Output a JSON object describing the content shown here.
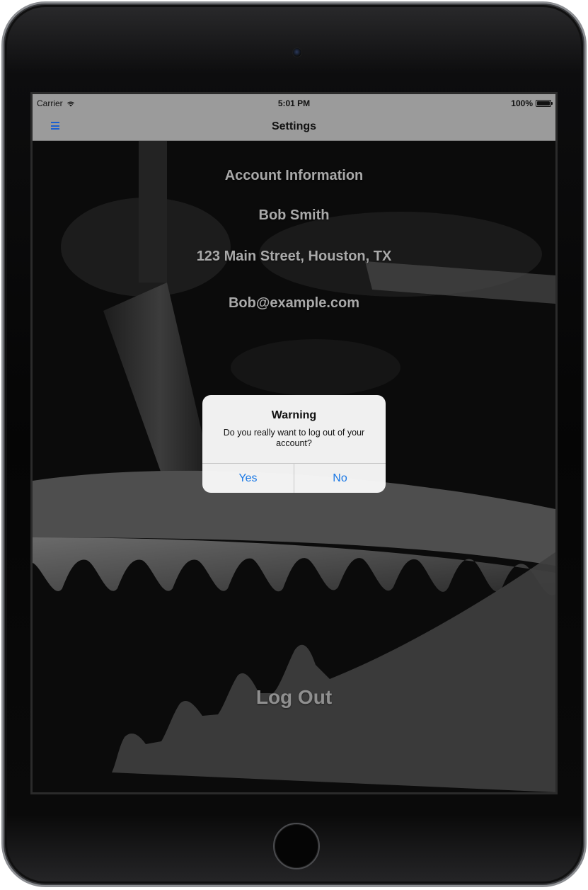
{
  "status_bar": {
    "carrier": "Carrier",
    "time": "5:01 PM",
    "battery": "100%",
    "battery_level": 1.0
  },
  "nav": {
    "title": "Settings",
    "menu_icon": "hamburger-menu-icon"
  },
  "account": {
    "heading": "Account Information",
    "name": "Bob Smith",
    "address": "123 Main Street, Houston, TX",
    "email": "Bob@example.com"
  },
  "logout_label": "Log Out",
  "dialog": {
    "title": "Warning",
    "message": "Do you really want to log out of your account?",
    "yes_label": "Yes",
    "no_label": "No"
  },
  "colors": {
    "bar": "#9b9b9b",
    "accent": "#1a78e5",
    "text": "#a9a9a9"
  }
}
